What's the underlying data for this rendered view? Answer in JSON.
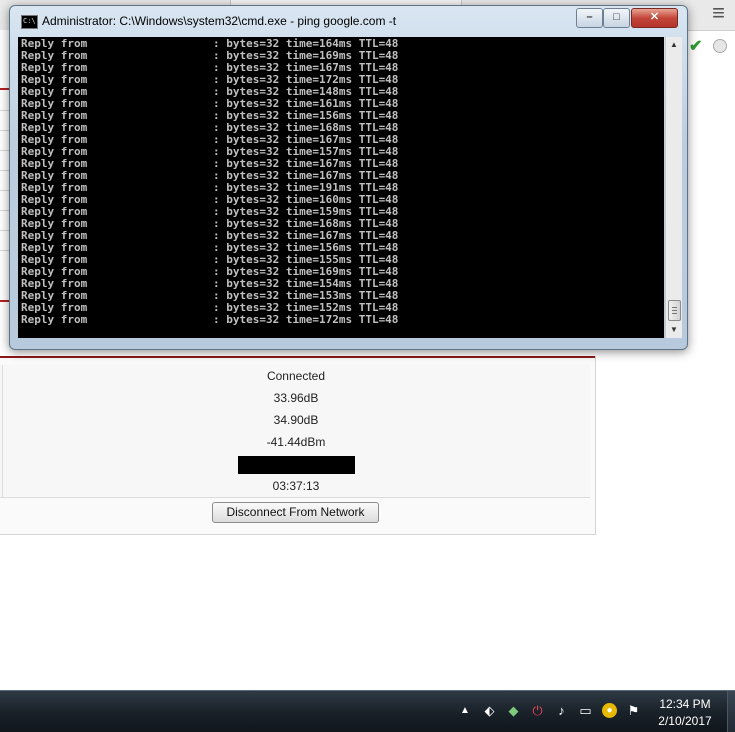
{
  "cmd": {
    "title": "Administrator: C:\\Windows\\system32\\cmd.exe - ping  google.com -t",
    "icon_text": "C:\\",
    "lines": [
      {
        "label": "Reply from",
        "rest": ": bytes=32 time=164ms TTL=48"
      },
      {
        "label": "Reply from",
        "rest": ": bytes=32 time=169ms TTL=48"
      },
      {
        "label": "Reply from",
        "rest": ": bytes=32 time=167ms TTL=48"
      },
      {
        "label": "Reply from",
        "rest": ": bytes=32 time=172ms TTL=48"
      },
      {
        "label": "Reply from",
        "rest": ": bytes=32 time=148ms TTL=48"
      },
      {
        "label": "Reply from",
        "rest": ": bytes=32 time=161ms TTL=48"
      },
      {
        "label": "Reply from",
        "rest": ": bytes=32 time=156ms TTL=48"
      },
      {
        "label": "Reply from",
        "rest": ": bytes=32 time=168ms TTL=48"
      },
      {
        "label": "Reply from",
        "rest": ": bytes=32 time=167ms TTL=48"
      },
      {
        "label": "Reply from",
        "rest": ": bytes=32 time=157ms TTL=48"
      },
      {
        "label": "Reply from",
        "rest": ": bytes=32 time=167ms TTL=48"
      },
      {
        "label": "Reply from",
        "rest": ": bytes=32 time=167ms TTL=48"
      },
      {
        "label": "Reply from",
        "rest": ": bytes=32 time=191ms TTL=48"
      },
      {
        "label": "Reply from",
        "rest": ": bytes=32 time=160ms TTL=48"
      },
      {
        "label": "Reply from",
        "rest": ": bytes=32 time=159ms TTL=48"
      },
      {
        "label": "Reply from",
        "rest": ": bytes=32 time=168ms TTL=48"
      },
      {
        "label": "Reply from",
        "rest": ": bytes=32 time=167ms TTL=48"
      },
      {
        "label": "Reply from",
        "rest": ": bytes=32 time=156ms TTL=48"
      },
      {
        "label": "Reply from",
        "rest": ": bytes=32 time=155ms TTL=48"
      },
      {
        "label": "Reply from",
        "rest": ": bytes=32 time=169ms TTL=48"
      },
      {
        "label": "Reply from",
        "rest": ": bytes=32 time=154ms TTL=48"
      },
      {
        "label": "Reply from",
        "rest": ": bytes=32 time=153ms TTL=48"
      },
      {
        "label": "Reply from",
        "rest": ": bytes=32 time=152ms TTL=48"
      },
      {
        "label": "Reply from",
        "rest": ": bytes=32 time=172ms TTL=48"
      }
    ],
    "buttons": {
      "minimize": "–",
      "maximize": "□",
      "close": "✕"
    }
  },
  "status": {
    "rows": [
      {
        "name": "connection-status",
        "value": "Connected"
      },
      {
        "name": "snr-value",
        "value": "33.96dB"
      },
      {
        "name": "snr2-value",
        "value": "34.90dB"
      },
      {
        "name": "rssi-value",
        "value": "-41.44dBm"
      },
      {
        "name": "redacted-value",
        "value": ""
      },
      {
        "name": "uptime-value",
        "value": "03:37:13"
      }
    ],
    "disconnect_label": "Disconnect From Network"
  },
  "taskbar": {
    "time": "12:34 PM",
    "date": "2/10/2017",
    "tray_icons": [
      "show-hidden-icons-icon",
      "network-drive-icon",
      "security-icon",
      "power-icon",
      "volume-icon",
      "display-icon",
      "chrome-icon",
      "flag-icon"
    ]
  },
  "colors": {
    "console_bg": "#000000",
    "console_text": "#c0c0c0",
    "accent_red": "#8b1a1a",
    "taskbar": "#1a222a"
  }
}
